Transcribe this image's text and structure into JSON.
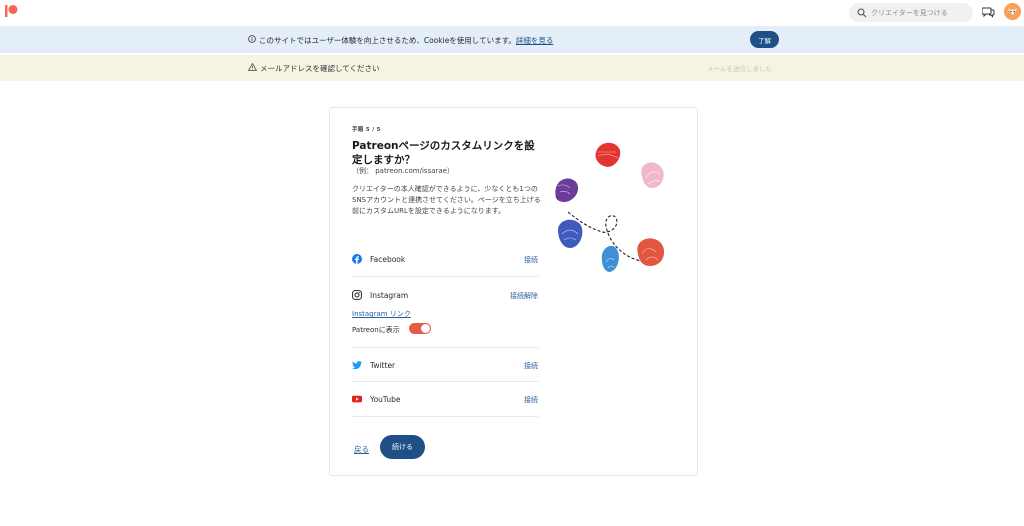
{
  "nav": {
    "search_placeholder": "クリエイターを見つける",
    "brand_color": "#f96854"
  },
  "cookie_banner": {
    "message": "このサイトではユーザー体験を向上させるため、Cookieを使用しています。",
    "link_text": "詳細を見る",
    "accept_label": "了解"
  },
  "email_banner": {
    "message": "メールアドレスを確認してください",
    "resend_label": "メールを送信しました"
  },
  "card": {
    "step_label": "手順 5 / 5",
    "title": "Patreonページのカスタムリンクを設定しますか？",
    "example": "（例： patreon.com/issarae）",
    "description": "クリエイターの本人確認ができるように、少なくとも1つのSNSアカウントと連携させてください。ページを立ち上げる前にカスタムURLを設定できるようになります。",
    "accounts": {
      "facebook": {
        "label": "Facebook",
        "action": "接続"
      },
      "instagram": {
        "label": "Instagram",
        "action": "接続解除",
        "link": "Instagram リンク",
        "show_on_patreon_label": "Patreonに表示",
        "show_on_patreon": true
      },
      "twitter": {
        "label": "Twitter",
        "action": "接続"
      },
      "youtube": {
        "label": "YouTube",
        "action": "接続"
      }
    },
    "back_label": "戻る",
    "continue_label": "続ける"
  },
  "colors": {
    "primary_button": "#1e4f86",
    "toggle_on": "#e65a4a",
    "link": "#2a5d9b"
  }
}
